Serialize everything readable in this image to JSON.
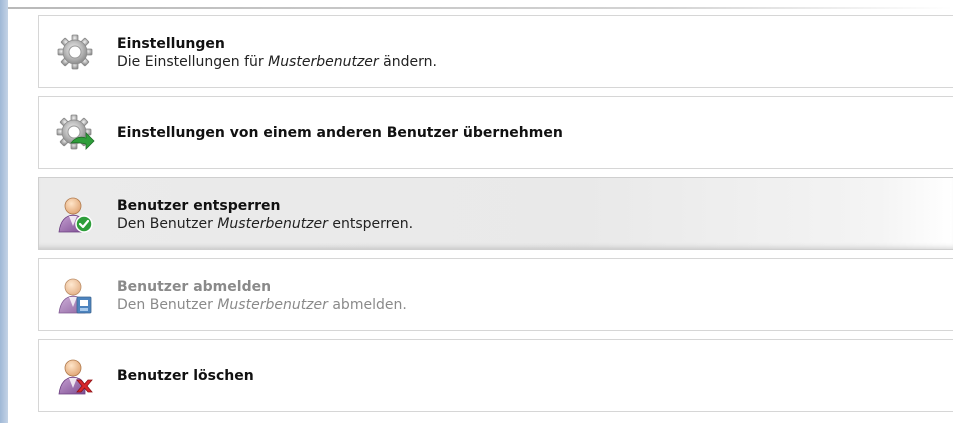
{
  "actions": [
    {
      "title": "Einstellungen",
      "desc_prefix": "Die Einstellungen für ",
      "desc_user": "Musterbenutzer",
      "desc_suffix": " ändern.",
      "icon": "gear-icon"
    },
    {
      "title": "Einstellungen von einem anderen Benutzer übernehmen",
      "icon": "gear-import-icon"
    },
    {
      "title": "Benutzer entsperren",
      "desc_prefix": "Den Benutzer ",
      "desc_user": "Musterbenutzer",
      "desc_suffix": " entsperren.",
      "icon": "user-unlock-icon",
      "state": "hovered"
    },
    {
      "title": "Benutzer abmelden",
      "desc_prefix": "Den Benutzer ",
      "desc_user": "Musterbenutzer",
      "desc_suffix": " abmelden.",
      "icon": "user-logout-icon",
      "state": "disabled"
    },
    {
      "title": "Benutzer löschen",
      "icon": "user-delete-icon"
    }
  ],
  "colors": {
    "sidebar_accent": "#a9bfdc",
    "check_green": "#2e9e3a",
    "delete_red": "#d8262b",
    "logout_blue": "#2f6fb4"
  }
}
